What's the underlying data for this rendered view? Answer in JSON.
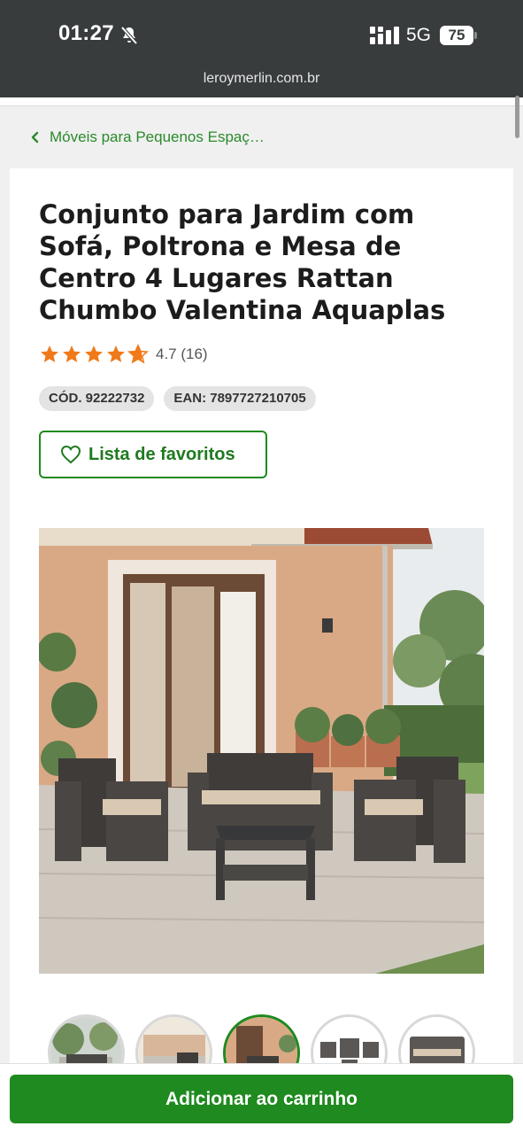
{
  "status_bar": {
    "time": "01:27",
    "network": "5G",
    "battery": "75",
    "url": "leroymerlin.com.br"
  },
  "breadcrumb": {
    "label": "Móveis para Pequenos Espaç…"
  },
  "product": {
    "title": "Conjunto para Jardim com Sofá, Poltrona e Mesa de Centro 4 Lugares Rattan Chumbo Valentina Aquaplas",
    "rating_value": 4.7,
    "rating_text": "4.7 (16)",
    "code": "CÓD. 92222732",
    "ean": "EAN: 7897727210705",
    "favorites_label": "Lista de favoritos",
    "thumbnails": [
      "thumb-1",
      "thumb-2",
      "thumb-3",
      "thumb-4",
      "thumb-5"
    ],
    "active_thumbnail": 3
  },
  "actions": {
    "add_to_cart": "Adicionar ao carrinho"
  },
  "colors": {
    "brand_green": "#1f8a1f",
    "star_orange": "#f07a1a",
    "status_bar_bg": "#383c3d"
  },
  "icons": [
    "bell-slash-icon",
    "signal-icon",
    "chevron-left-icon",
    "star-icon",
    "heart-icon"
  ]
}
